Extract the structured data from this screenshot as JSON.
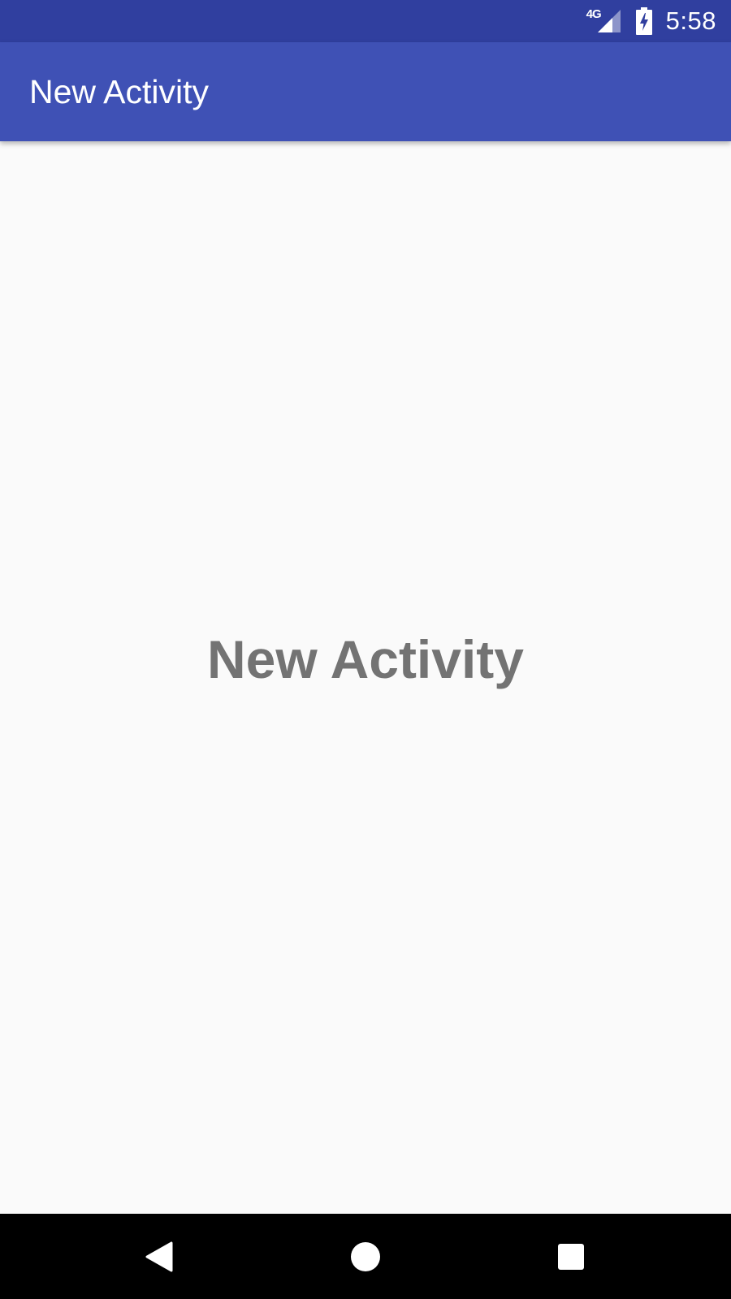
{
  "status_bar": {
    "network_type": "4G",
    "signal_icon": "signal-icon",
    "battery_icon": "battery-charging-icon",
    "time": "5:58",
    "color": "#303f9f"
  },
  "app_bar": {
    "title": "New Activity",
    "color": "#3f51b5"
  },
  "content": {
    "label": "New Activity",
    "text_color": "#737373",
    "background": "#fafafa"
  },
  "nav_bar": {
    "back_icon": "back-icon",
    "home_icon": "home-icon",
    "recents_icon": "recents-icon"
  }
}
